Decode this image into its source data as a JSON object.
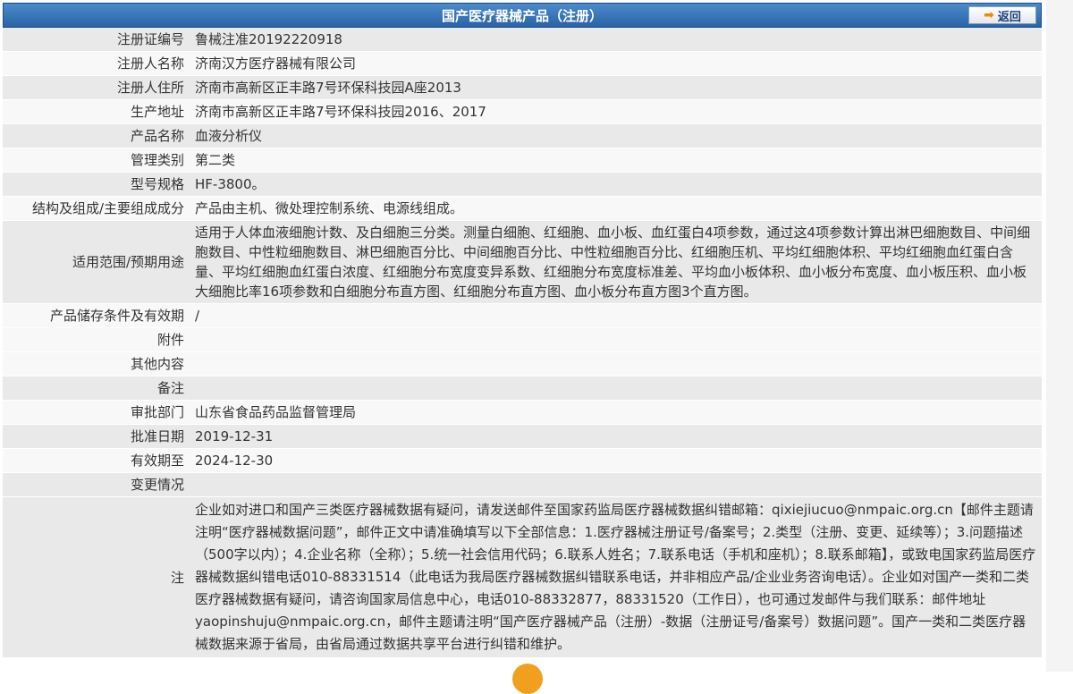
{
  "header": {
    "title": "国产医疗器械产品（注册）",
    "back_label": "返回"
  },
  "rows": [
    {
      "label": "注册证编号",
      "value": "鲁械注准20192220918"
    },
    {
      "label": "注册人名称",
      "value": "济南汉方医疗器械有限公司"
    },
    {
      "label": "注册人住所",
      "value": "济南市高新区正丰路7号环保科技园A座2013"
    },
    {
      "label": "生产地址",
      "value": "济南市高新区正丰路7号环保科技园2016、2017"
    },
    {
      "label": "产品名称",
      "value": "血液分析仪"
    },
    {
      "label": "管理类别",
      "value": "第二类"
    },
    {
      "label": "型号规格",
      "value": "HF-3800。"
    },
    {
      "label": "结构及组成/主要组成成分",
      "value": "产品由主机、微处理控制系统、电源线组成。"
    },
    {
      "label": "适用范围/预期用途",
      "value": "适用于人体血液细胞计数、及白细胞三分类。测量白细胞、红细胞、血小板、血红蛋白4项参数，通过这4项参数计算出淋巴细胞数目、中间细胞数目、中性粒细胞数目、淋巴细胞百分比、中间细胞百分比、中性粒细胞百分比、红细胞压机、平均红细胞体积、平均红细胞血红蛋白含量、平均红细胞血红蛋白浓度、红细胞分布宽度变异系数、红细胞分布宽度标准差、平均血小板体积、血小板分布宽度、血小板压积、血小板大细胞比率16项参数和白细胞分布直方图、红细胞分布直方图、血小板分布直方图3个直方图。"
    },
    {
      "label": "产品储存条件及有效期",
      "value": "/"
    },
    {
      "label": "附件",
      "value": ""
    },
    {
      "label": "其他内容",
      "value": ""
    },
    {
      "label": "备注",
      "value": ""
    },
    {
      "label": "审批部门",
      "value": "山东省食品药品监督管理局"
    },
    {
      "label": "批准日期",
      "value": "2019-12-31"
    },
    {
      "label": "有效期至",
      "value": "2024-12-30"
    },
    {
      "label": "变更情况",
      "value": ""
    }
  ],
  "note": {
    "label": "注",
    "text": "企业如对进口和国产三类医疗器械数据有疑问，请发送邮件至国家药监局医疗器械数据纠错邮箱：qixiejiucuo@nmpaic.org.cn【邮件主题请注明“医疗器械数据问题”，邮件正文中请准确填写以下全部信息：1.医疗器械注册证号/备案号；2.类型（注册、变更、延续等）；3.问题描述（500字以内）；4.企业名称（全称）；5.统一社会信用代码；6.联系人姓名；7.联系电话（手机和座机）；8.联系邮箱】，或致电国家药监局医疗器械数据纠错电话010-88331514（此电话为我局医疗器械数据纠错联系电话，并非相应产品/企业业务咨询电话）。企业如对国产一类和二类医疗器械数据有疑问，请咨询国家局信息中心，电话010-88332877，88331520（工作日），也可通过发邮件与我们联系：邮件地址yaopinshuju@nmpaic.org.cn，邮件主题请注明“国产医疗器械产品（注册）-数据（注册证号/备案号）数据问题”。国产一类和二类医疗器械数据来源于省局，由省局通过数据共享平台进行纠错和维护。"
  }
}
